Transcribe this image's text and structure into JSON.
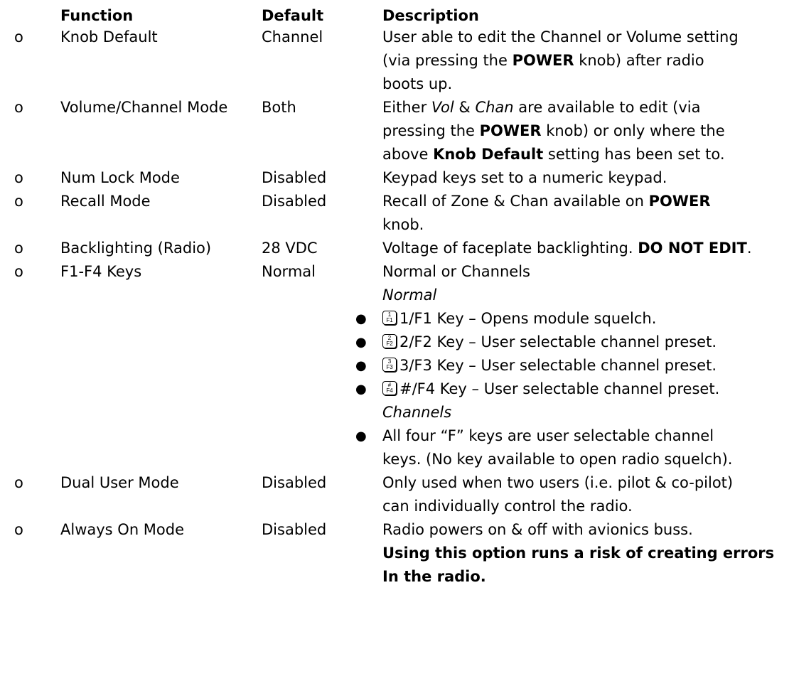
{
  "header": {
    "function": "Function",
    "default": "Default",
    "description": "Description"
  },
  "bullet_glyph": "o",
  "rows": [
    {
      "function": "Knob Default",
      "default": "Channel",
      "desc": {
        "l1": "User able to edit the Channel or Volume setting",
        "l2a": "(via pressing the ",
        "l2b": "POWER",
        "l2c": " knob) after radio",
        "l3": "boots up."
      }
    },
    {
      "function": "Volume/Channel Mode",
      "default": "Both",
      "desc": {
        "l1a": "Either ",
        "l1b": "Vol",
        "l1c": " & ",
        "l1d": "Chan",
        "l1e": " are available to edit (via",
        "l2a": "pressing the ",
        "l2b": "POWER",
        "l2c": " knob) or only where the",
        "l3a": "above ",
        "l3b": "Knob Default",
        "l3c": " setting has been set to."
      }
    },
    {
      "function": "Num Lock Mode",
      "default": "Disabled",
      "desc": {
        "l1": "Keypad keys set to a numeric keypad."
      }
    },
    {
      "function": "Recall Mode",
      "default": "Disabled",
      "desc": {
        "l1a": "Recall of Zone & Chan available on ",
        "l1b": "POWER",
        "l2": "knob."
      }
    },
    {
      "function": "Backlighting (Radio)",
      "default": "28 VDC",
      "desc": {
        "l1a": "Voltage of faceplate backlighting. ",
        "l1b": "DO NOT EDIT",
        "l1c": "."
      }
    },
    {
      "function": "F1-F4 Keys",
      "default": "Normal",
      "desc": {
        "l1": "Normal or Channels",
        "normal_heading": "Normal",
        "channels_heading": "Channels"
      }
    },
    {
      "function": "Dual User Mode",
      "default": "Disabled",
      "desc": {
        "l1": "Only used when two users (i.e. pilot & co-pilot)",
        "l2": "can individually control the radio."
      }
    },
    {
      "function": "Always On Mode",
      "default": "Disabled",
      "desc": {
        "l1": "Radio powers on & off with avionics buss.",
        "l2": "Using this option runs a risk of creating errors",
        "l3": "In the radio."
      }
    }
  ],
  "fkeys": [
    {
      "top": "1",
      "bottom": "F1",
      "text": "1/F1 Key – Opens module squelch."
    },
    {
      "top": "2",
      "bottom": "F2",
      "text": "2/F2 Key – User selectable channel preset."
    },
    {
      "top": "3",
      "bottom": "F3",
      "text": "3/F3 Key – User selectable channel preset."
    },
    {
      "top": "#",
      "bottom": "F4",
      "text": "#/F4 Key – User selectable channel preset."
    }
  ],
  "channels_note": {
    "l1": "All four “F” keys are user selectable channel",
    "l2": "keys. (No key available to open radio squelch)."
  },
  "list_bullet": "●"
}
